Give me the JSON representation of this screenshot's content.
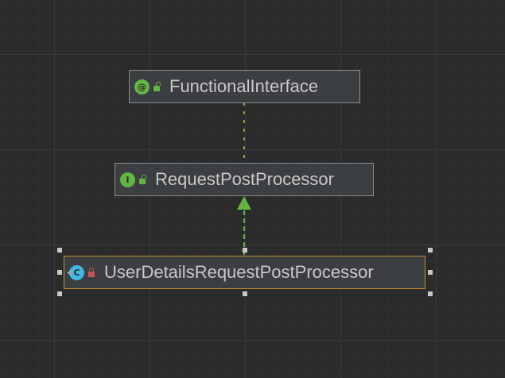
{
  "diagram": {
    "nodes": [
      {
        "id": "functional-interface",
        "kind": "annotation",
        "icon_letter": "@",
        "visibility": "public",
        "label": "FunctionalInterface"
      },
      {
        "id": "request-post-processor",
        "kind": "interface",
        "icon_letter": "I",
        "visibility": "public",
        "label": "RequestPostProcessor"
      },
      {
        "id": "user-details-request-post-processor",
        "kind": "class",
        "icon_letter": "C",
        "visibility": "private",
        "label": "UserDetailsRequestPostProcessor",
        "selected": true
      }
    ],
    "edges": [
      {
        "from": "request-post-processor",
        "to": "functional-interface",
        "type": "annotated-with",
        "color": "#a5a84a"
      },
      {
        "from": "user-details-request-post-processor",
        "to": "request-post-processor",
        "type": "implements",
        "color": "#62b543"
      }
    ]
  },
  "colors": {
    "background": "#2b2b2b",
    "node_fill": "#3c3f41",
    "node_border": "#8a8a8a",
    "selected_border": "#c38b3d",
    "interface_icon": "#62b543",
    "class_icon": "#40b6e0",
    "public_lock": "#62b543",
    "private_lock": "#c75450"
  }
}
